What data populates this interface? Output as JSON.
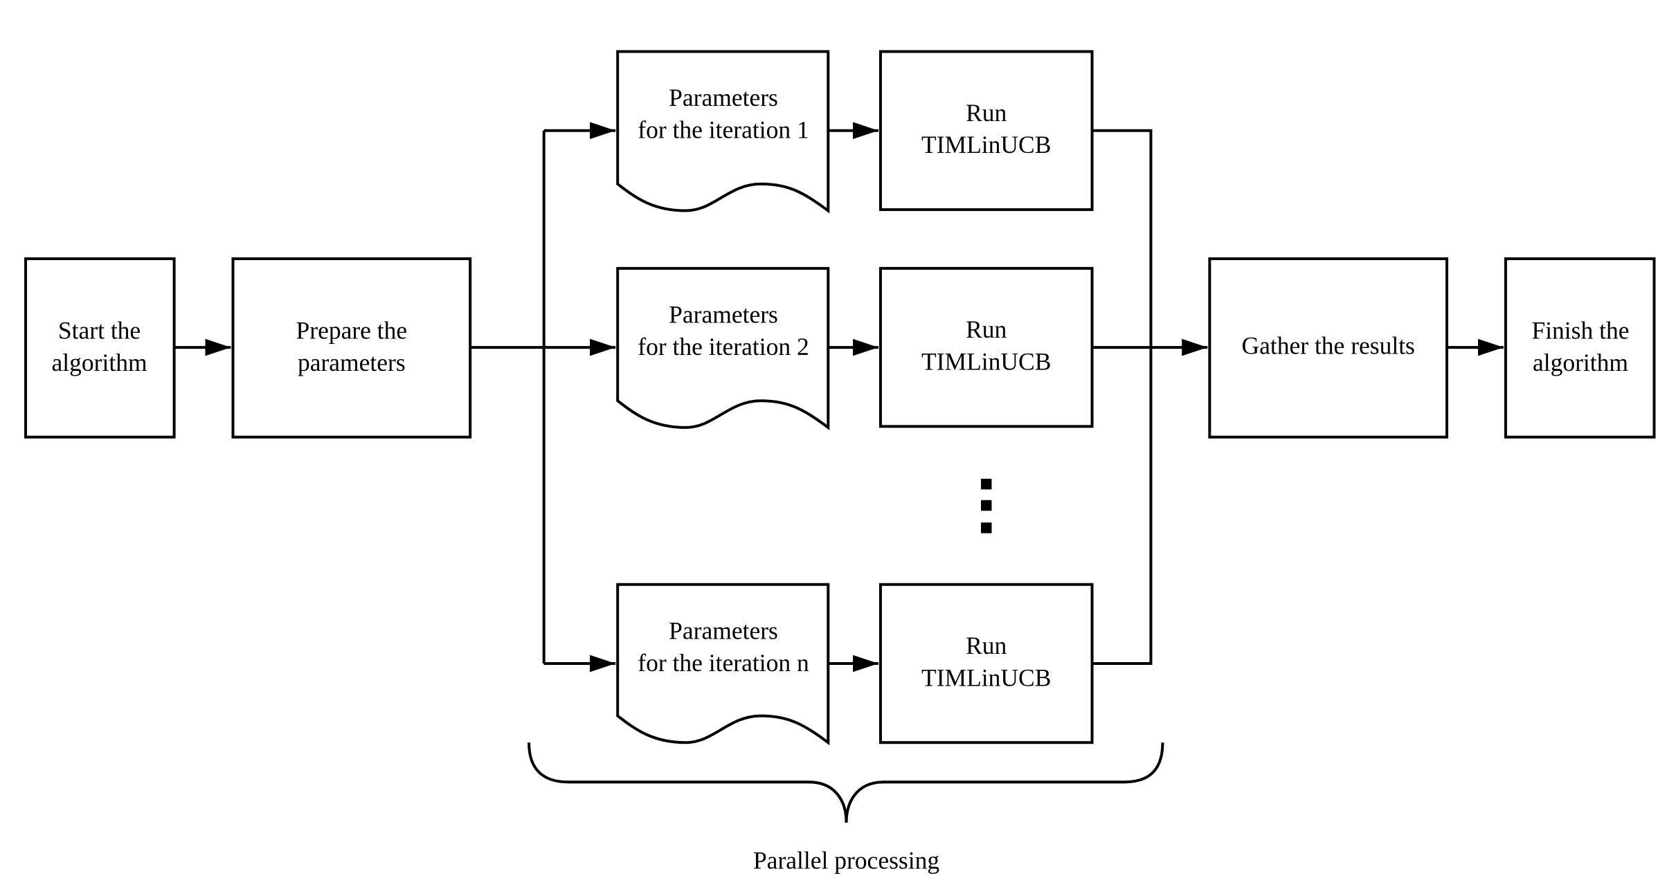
{
  "nodes": {
    "start": [
      "Start the",
      "algorithm"
    ],
    "prepare": [
      "Prepare the",
      "parameters"
    ],
    "params": [
      [
        "Parameters",
        "for the iteration 1"
      ],
      [
        "Parameters",
        "for the iteration 2"
      ],
      [
        "Parameters",
        "for the iteration n"
      ]
    ],
    "run": [
      [
        "Run",
        "TIMLinUCB"
      ],
      [
        "Run",
        "TIMLinUCB"
      ],
      [
        "Run",
        "TIMLinUCB"
      ]
    ],
    "gather": "Gather the results",
    "finish": [
      "Finish the",
      "algorithm"
    ]
  },
  "brace_label": "Parallel processing",
  "colors": {
    "stroke": "#000000",
    "background": "#ffffff"
  }
}
